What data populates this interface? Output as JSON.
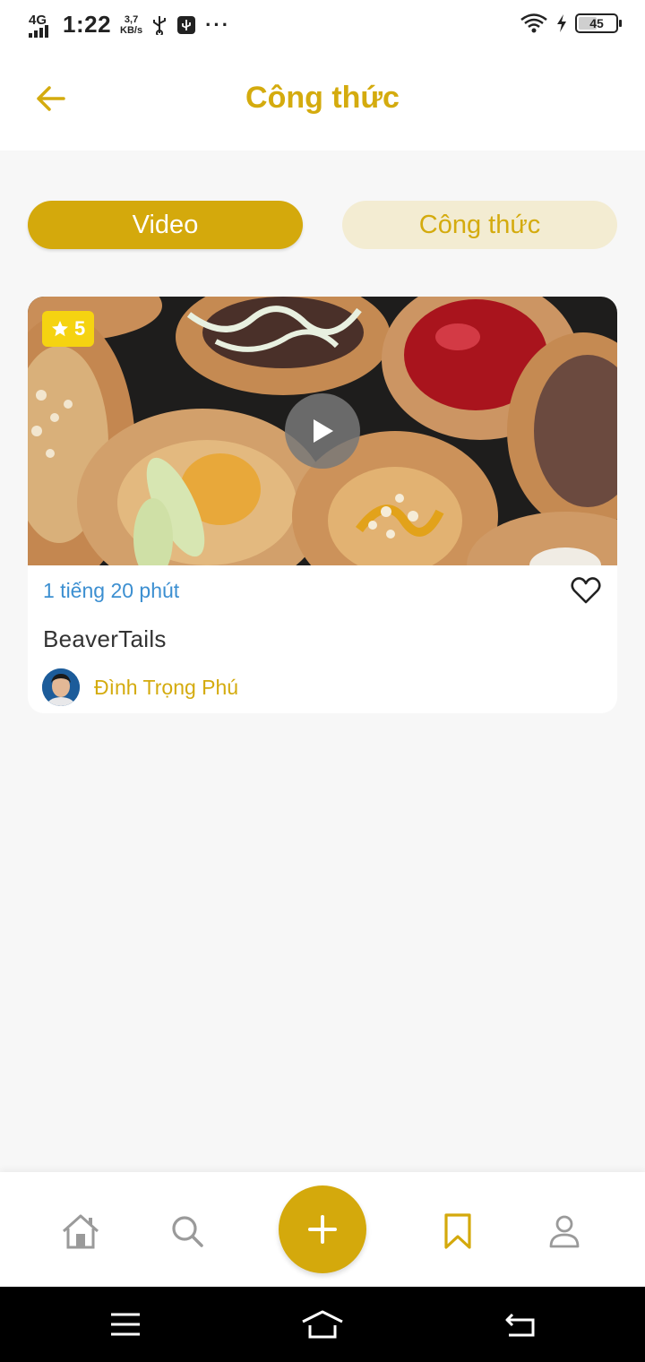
{
  "status_bar": {
    "network": "4G",
    "time": "1:22",
    "speed_value": "3,7",
    "speed_unit": "KB/s",
    "more": "···",
    "battery": "45"
  },
  "header": {
    "title": "Công thức"
  },
  "segments": {
    "video_label": "Video",
    "recipe_label": "Công thức"
  },
  "card": {
    "rating": "5",
    "duration": "1 tiếng 20 phút",
    "name": "BeaverTails",
    "author": "Đình Trọng Phú"
  },
  "icons": {
    "back": "arrow-left-icon",
    "rating": "star-icon",
    "play": "play-icon",
    "favorite": "heart-outline-icon",
    "nav": [
      "home-icon",
      "search-icon",
      "plus-icon",
      "bookmark-icon",
      "user-icon"
    ],
    "system": [
      "menu-icon",
      "home-outline-icon",
      "back-return-icon"
    ]
  },
  "colors": {
    "accent": "#d4a90c",
    "accent_light": "#f3ecd2",
    "link_blue": "#3c8fd1",
    "rating_badge": "#f5d311"
  }
}
